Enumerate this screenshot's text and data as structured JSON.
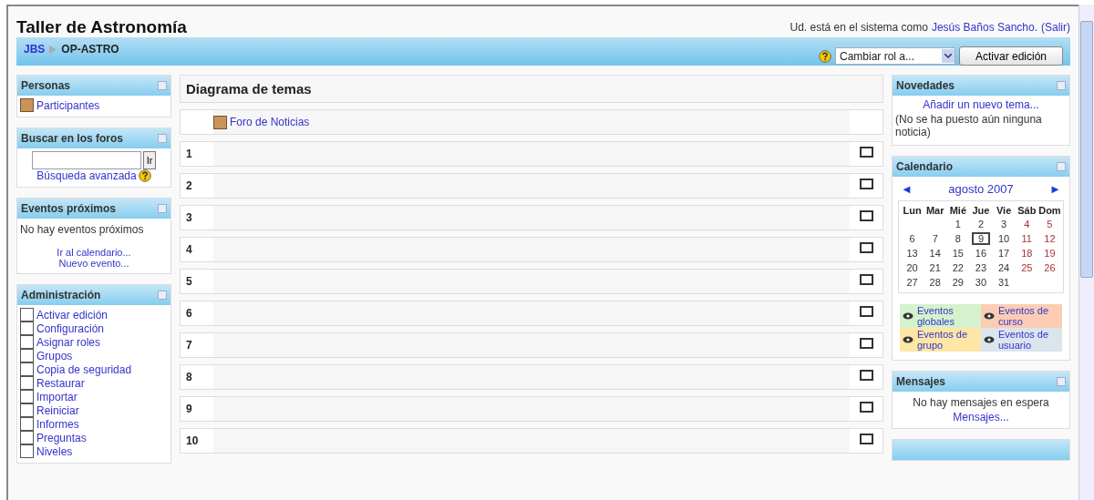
{
  "header": {
    "title": "Taller de Astronomía",
    "login_prefix": "Ud. está en el sistema como",
    "user": "Jesús Baños Sancho.",
    "logout": "(Salir)"
  },
  "navbar": {
    "breadcrumb": [
      "JBS",
      "OP-ASTRO"
    ],
    "role_select": "Cambiar rol a...",
    "edit_button": "Activar edición"
  },
  "left": {
    "people": {
      "title": "Personas",
      "link": "Participantes"
    },
    "search": {
      "title": "Buscar en los foros",
      "go": "Ir",
      "advanced": "Búsqueda avanzada"
    },
    "events": {
      "title": "Eventos próximos",
      "empty": "No hay eventos próximos",
      "links": [
        "Ir al calendario...",
        "Nuevo evento..."
      ]
    },
    "admin": {
      "title": "Administración",
      "items": [
        "Activar edición",
        "Configuración",
        "Asignar roles",
        "Grupos",
        "Copia de seguridad",
        "Restaurar",
        "Importar",
        "Reiniciar",
        "Informes",
        "Preguntas",
        "Niveles"
      ]
    }
  },
  "main": {
    "title": "Diagrama de temas",
    "forum": "Foro de Noticias",
    "sections": [
      "1",
      "2",
      "3",
      "4",
      "5",
      "6",
      "7",
      "8",
      "9",
      "10"
    ]
  },
  "right": {
    "news": {
      "title": "Novedades",
      "add": "Añadir un nuevo tema...",
      "empty": "(No se ha puesto aún ninguna noticia)"
    },
    "calendar": {
      "title": "Calendario",
      "prev": "◄",
      "month": "agosto 2007",
      "next": "►",
      "weekdays": [
        "Lun",
        "Mar",
        "Mié",
        "Jue",
        "Vie",
        "Sáb",
        "Dom"
      ],
      "weeks": [
        {
          "right_aligned": true,
          "days": [
            {
              "d": "1",
              "weekend": false,
              "today": false
            },
            {
              "d": "2",
              "weekend": false,
              "today": false
            },
            {
              "d": "3",
              "weekend": false,
              "today": false
            },
            {
              "d": "4",
              "weekend": true,
              "today": false
            },
            {
              "d": "5",
              "weekend": true,
              "today": false
            }
          ]
        },
        {
          "days": [
            {
              "d": "6",
              "weekend": false,
              "today": false
            },
            {
              "d": "7",
              "weekend": false,
              "today": false
            },
            {
              "d": "8",
              "weekend": false,
              "today": false
            },
            {
              "d": "9",
              "weekend": false,
              "today": true
            },
            {
              "d": "10",
              "weekend": false,
              "today": false
            },
            {
              "d": "11",
              "weekend": true,
              "today": false
            },
            {
              "d": "12",
              "weekend": true,
              "today": false
            }
          ]
        },
        {
          "days": [
            {
              "d": "13",
              "weekend": false,
              "today": false
            },
            {
              "d": "14",
              "weekend": false,
              "today": false
            },
            {
              "d": "15",
              "weekend": false,
              "today": false
            },
            {
              "d": "16",
              "weekend": false,
              "today": false
            },
            {
              "d": "17",
              "weekend": false,
              "today": false
            },
            {
              "d": "18",
              "weekend": true,
              "today": false
            },
            {
              "d": "19",
              "weekend": true,
              "today": false
            }
          ]
        },
        {
          "days": [
            {
              "d": "20",
              "weekend": false,
              "today": false
            },
            {
              "d": "21",
              "weekend": false,
              "today": false
            },
            {
              "d": "22",
              "weekend": false,
              "today": false
            },
            {
              "d": "23",
              "weekend": false,
              "today": false
            },
            {
              "d": "24",
              "weekend": false,
              "today": false
            },
            {
              "d": "25",
              "weekend": true,
              "today": false
            },
            {
              "d": "26",
              "weekend": true,
              "today": false
            }
          ]
        },
        {
          "days": [
            {
              "d": "27",
              "weekend": false,
              "today": false
            },
            {
              "d": "28",
              "weekend": false,
              "today": false
            },
            {
              "d": "29",
              "weekend": false,
              "today": false
            },
            {
              "d": "30",
              "weekend": false,
              "today": false
            },
            {
              "d": "31",
              "weekend": false,
              "today": false
            }
          ]
        }
      ],
      "legend": [
        {
          "label": "Eventos globales",
          "color": "#d4f2cc"
        },
        {
          "label": "Eventos de curso",
          "color": "#fccdb4"
        },
        {
          "label": "Eventos de grupo",
          "color": "#fde6a6"
        },
        {
          "label": "Eventos de usuario",
          "color": "#dce4ec"
        }
      ]
    },
    "messages": {
      "title": "Mensajes",
      "empty": "No hay mensajes en espera",
      "link": "Mensajes..."
    }
  }
}
